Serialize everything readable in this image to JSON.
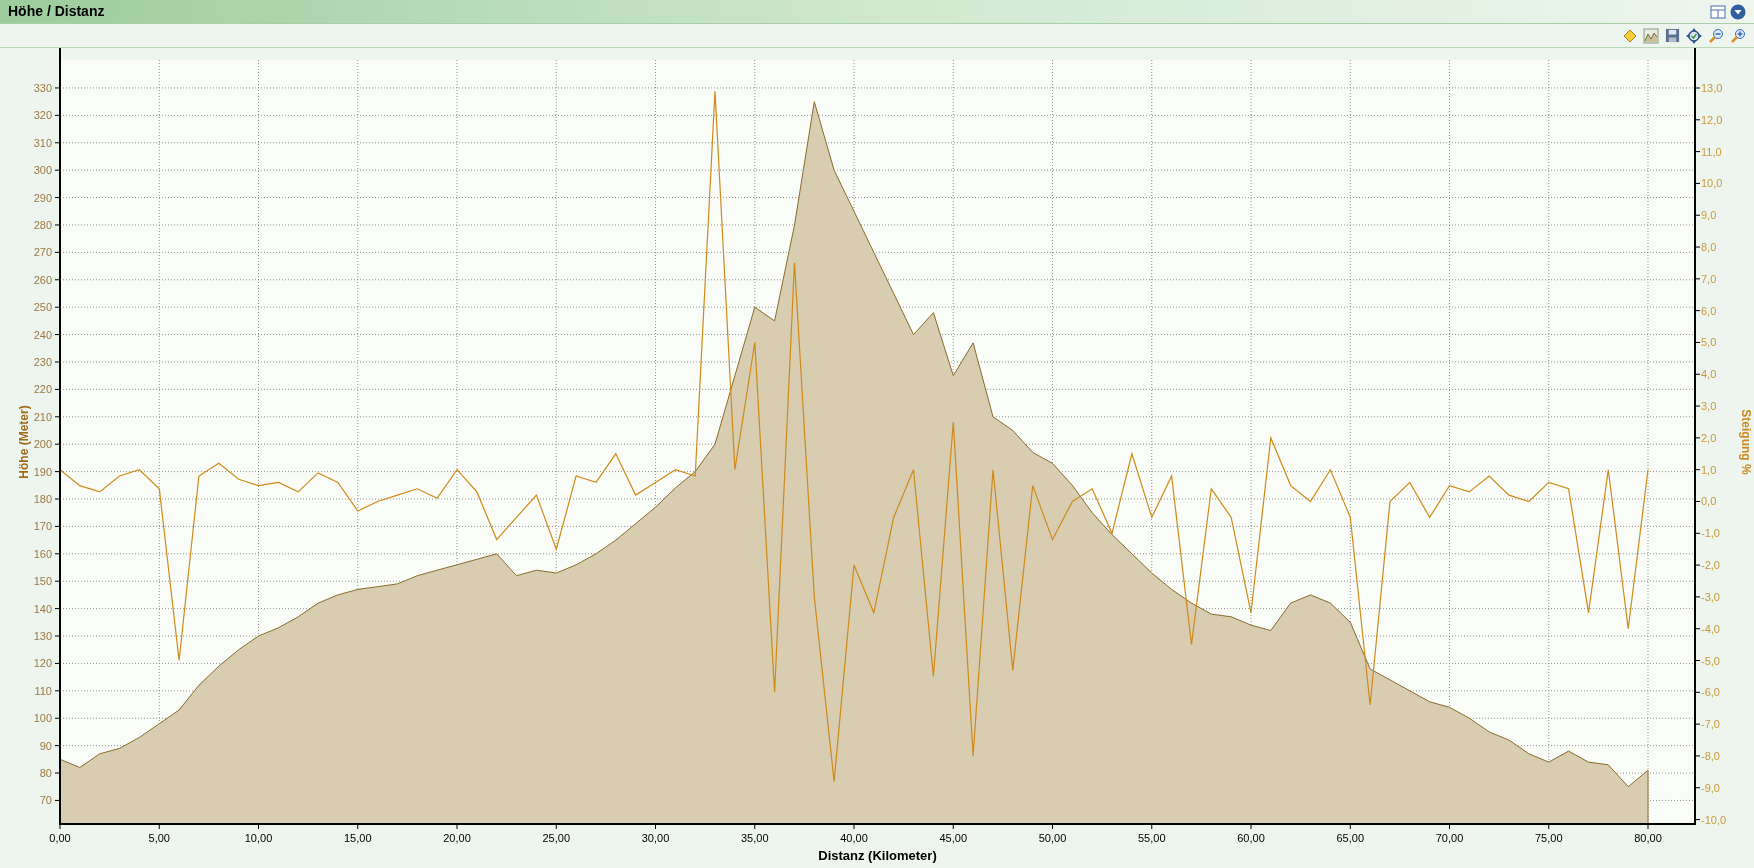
{
  "window": {
    "title": "Höhe / Distanz"
  },
  "chart": {
    "chart_data": {
      "type": "area",
      "xlabel": "Distanz (Kilometer)",
      "ylabel": "Höhe (Meter)",
      "y2label": "Steigung %",
      "x": [
        0,
        1,
        2,
        3,
        4,
        5,
        6,
        7,
        8,
        9,
        10,
        11,
        12,
        13,
        14,
        15,
        16,
        17,
        18,
        19,
        20,
        21,
        22,
        23,
        24,
        25,
        26,
        27,
        28,
        29,
        30,
        31,
        32,
        33,
        34,
        35,
        36,
        37,
        38,
        39,
        40,
        41,
        42,
        43,
        44,
        45,
        46,
        47,
        48,
        49,
        50,
        51,
        52,
        53,
        54,
        55,
        56,
        57,
        58,
        59,
        60,
        61,
        62,
        63,
        64,
        65,
        66,
        67,
        68,
        69,
        70,
        71,
        72,
        73,
        74,
        75,
        76,
        77,
        78,
        79,
        80
      ],
      "series": [
        {
          "color": "#d8cdb0",
          "values": [
            85,
            82,
            87,
            89,
            93,
            98,
            103,
            112,
            119,
            125,
            130,
            133,
            137,
            142,
            145,
            147,
            148,
            149,
            152,
            154,
            156,
            158,
            160,
            152,
            154,
            153,
            156,
            160,
            165,
            171,
            177,
            184,
            190,
            200,
            225,
            250,
            245,
            280,
            325,
            300,
            285,
            270,
            255,
            240,
            248,
            225,
            237,
            210,
            205,
            197,
            193,
            185,
            175,
            167,
            160,
            153,
            147,
            142,
            138,
            137,
            134,
            132,
            142,
            145,
            142,
            135,
            118,
            114,
            110,
            106,
            104,
            100,
            95,
            92,
            87,
            84,
            88,
            84,
            83,
            75,
            81
          ]
        },
        {
          "type": "line",
          "axis": "y2",
          "color": "#d08a1a",
          "values": [
            1.0,
            0.5,
            0.3,
            0.8,
            1.0,
            0.4,
            -5.0,
            0.8,
            1.2,
            0.7,
            0.5,
            0.6,
            0.3,
            0.9,
            0.6,
            -0.3,
            0.0,
            0.2,
            0.4,
            0.1,
            1.0,
            0.3,
            -1.2,
            -0.5,
            0.2,
            -1.5,
            0.8,
            0.6,
            1.5,
            0.2,
            0.6,
            1.0,
            0.8,
            12.9,
            1.0,
            5.0,
            -6.0,
            7.5,
            -3.0,
            -8.8,
            -2.0,
            -3.5,
            -0.5,
            1.0,
            -5.5,
            2.5,
            -8.0,
            1.0,
            -5.3,
            0.5,
            -1.2,
            0.0,
            0.4,
            -1.0,
            1.5,
            -0.5,
            0.8,
            -4.5,
            0.4,
            -0.5,
            -3.5,
            2.0,
            0.5,
            0.0,
            1.0,
            -0.5,
            -6.4,
            0.0,
            0.6,
            -0.5,
            0.5,
            0.3,
            0.8,
            0.2,
            0.0,
            0.6,
            0.4,
            -3.5,
            1.0,
            -4.0,
            1.0
          ]
        }
      ],
      "grid": true,
      "xlim": [
        0,
        80
      ],
      "ylim": [
        61.4,
        340.2
      ],
      "y2lim": [
        -10.14,
        13.88
      ],
      "xticks": [
        {
          "value": 0,
          "label": "0,00"
        },
        {
          "value": 5,
          "label": "5,00"
        },
        {
          "value": 10,
          "label": "10,00"
        },
        {
          "value": 15,
          "label": "15,00"
        },
        {
          "value": 20,
          "label": "20,00"
        },
        {
          "value": 25,
          "label": "25,00"
        },
        {
          "value": 30,
          "label": "30,00"
        },
        {
          "value": 35,
          "label": "35,00"
        },
        {
          "value": 40,
          "label": "40,00"
        },
        {
          "value": 45,
          "label": "45,00"
        },
        {
          "value": 50,
          "label": "50,00"
        },
        {
          "value": 55,
          "label": "55,00"
        },
        {
          "value": 60,
          "label": "60,00"
        },
        {
          "value": 65,
          "label": "65,00"
        },
        {
          "value": 70,
          "label": "70,00"
        },
        {
          "value": 75,
          "label": "75,00"
        },
        {
          "value": 80,
          "label": "80,00"
        }
      ],
      "yticks": [
        70,
        80,
        90,
        100,
        110,
        120,
        130,
        140,
        150,
        160,
        170,
        180,
        190,
        200,
        210,
        220,
        230,
        240,
        250,
        260,
        270,
        280,
        290,
        300,
        310,
        320,
        330
      ],
      "y2ticks": [
        {
          "value": 13,
          "label": "13,0"
        },
        {
          "value": 12,
          "label": "12,0"
        },
        {
          "value": 11,
          "label": "11,0"
        },
        {
          "value": 10,
          "label": "10,0"
        },
        {
          "value": 9,
          "label": "9,0"
        },
        {
          "value": 8,
          "label": "8,0"
        },
        {
          "value": 7,
          "label": "7,0"
        },
        {
          "value": 6,
          "label": "6,0"
        },
        {
          "value": 5,
          "label": "5,0"
        },
        {
          "value": 4,
          "label": "4,0"
        },
        {
          "value": 3,
          "label": "3,0"
        },
        {
          "value": 2,
          "label": "2,0"
        },
        {
          "value": 1,
          "label": "1,0"
        },
        {
          "value": 0,
          "label": "0,0"
        },
        {
          "value": -1,
          "label": "-1,0"
        },
        {
          "value": -2,
          "label": "-2,0"
        },
        {
          "value": -3,
          "label": "-3,0"
        },
        {
          "value": -4,
          "label": "-4,0"
        },
        {
          "value": -5,
          "label": "-5,0"
        },
        {
          "value": -6,
          "label": "-6,0"
        },
        {
          "value": -7,
          "label": "-7,0"
        },
        {
          "value": -8,
          "label": "-8,0"
        },
        {
          "value": -9,
          "label": "-9,0"
        },
        {
          "value": -10,
          "label": "-10,0"
        }
      ]
    }
  }
}
